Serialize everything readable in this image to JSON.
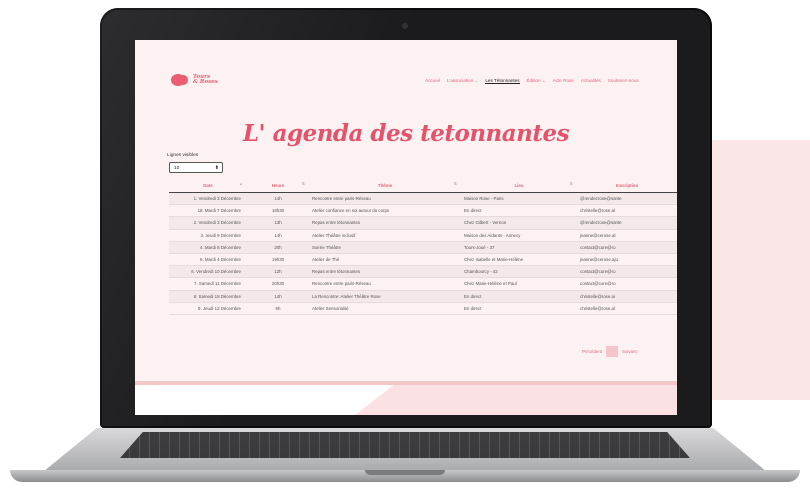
{
  "site": {
    "logo_text_line1": "Tours",
    "logo_text_line2": "& Roses",
    "nav": [
      "Accueil",
      "L'association ⌄",
      "Les Tétonnantes",
      "Édition ⌄",
      "Acte Rose",
      "Actualités",
      "Soutenez-nous"
    ],
    "page_title": "L' agenda des tetonnantes",
    "entries_label": "Lignes visibles",
    "entries_value": "10",
    "table": {
      "columns": [
        "Date",
        "Heure",
        "Thème",
        "Lieu",
        "Inscription"
      ],
      "rows": [
        [
          "1. Vendredi 3 Décembre",
          "14h",
          "Rencontre entre pairs-Réseau",
          "Maison Rose - Paris",
          "@rendezrose@sante"
        ],
        [
          "18. Mardi 7 Décembre",
          "18h30",
          "Atelier confiance en soi autour du corps",
          "En direct",
          "christelle@rose.al"
        ],
        [
          "2. Vendredi 3 Décembre",
          "13h",
          "Repas entre tétonnantes",
          "Chez Gilbert - Vernon",
          "@rendezrose@sante"
        ],
        [
          "3. Jeudi 9 Décembre",
          "14h",
          "Atelier Théâtre inclusif",
          "Maison des Aidants - Annecy",
          "jeanne@cerose.al"
        ],
        [
          "4. Mardi 8 Décembre",
          "20h",
          "Soirée Théâtre",
          "Tours-Joué - 37",
          "contact@cure@ro"
        ],
        [
          "5. Mardi 4 Décembre",
          "19h30",
          "Atelier de Thé",
          "Chez Isabelle et Marie-Hélène",
          "jeanne@cerose.aju"
        ],
        [
          "6. Vendredi 10 Décembre",
          "12h",
          "Repas entre tétonnantes",
          "Chambourcy - 42",
          "contact@cure@ro"
        ],
        [
          "7. Samedi 11 Décembre",
          "20h30",
          "Rencontre entre pairs-Réseau",
          "Chez Marie-Hélène et Paul",
          "contact@cure@ro"
        ],
        [
          "8. Samedi 18 Décembre",
          "14h",
          "La Rencontre: Atelier Théâtre Rose",
          "En direct",
          "christelle@rose.ai"
        ],
        [
          "9. Jeudi 12 Décembre",
          "9h",
          "Atelier Sensorialité",
          "En direct",
          "christelle@rose.al"
        ]
      ]
    },
    "pager": {
      "prev_label": "Précédent",
      "current_page": "",
      "next_label": "Suivant"
    }
  },
  "colors": {
    "accent": "#e5526b",
    "site_background": "#fcf2f2",
    "laptop_bezel": "#1b1b1d",
    "pager_highlight": "#f4c5cb"
  }
}
